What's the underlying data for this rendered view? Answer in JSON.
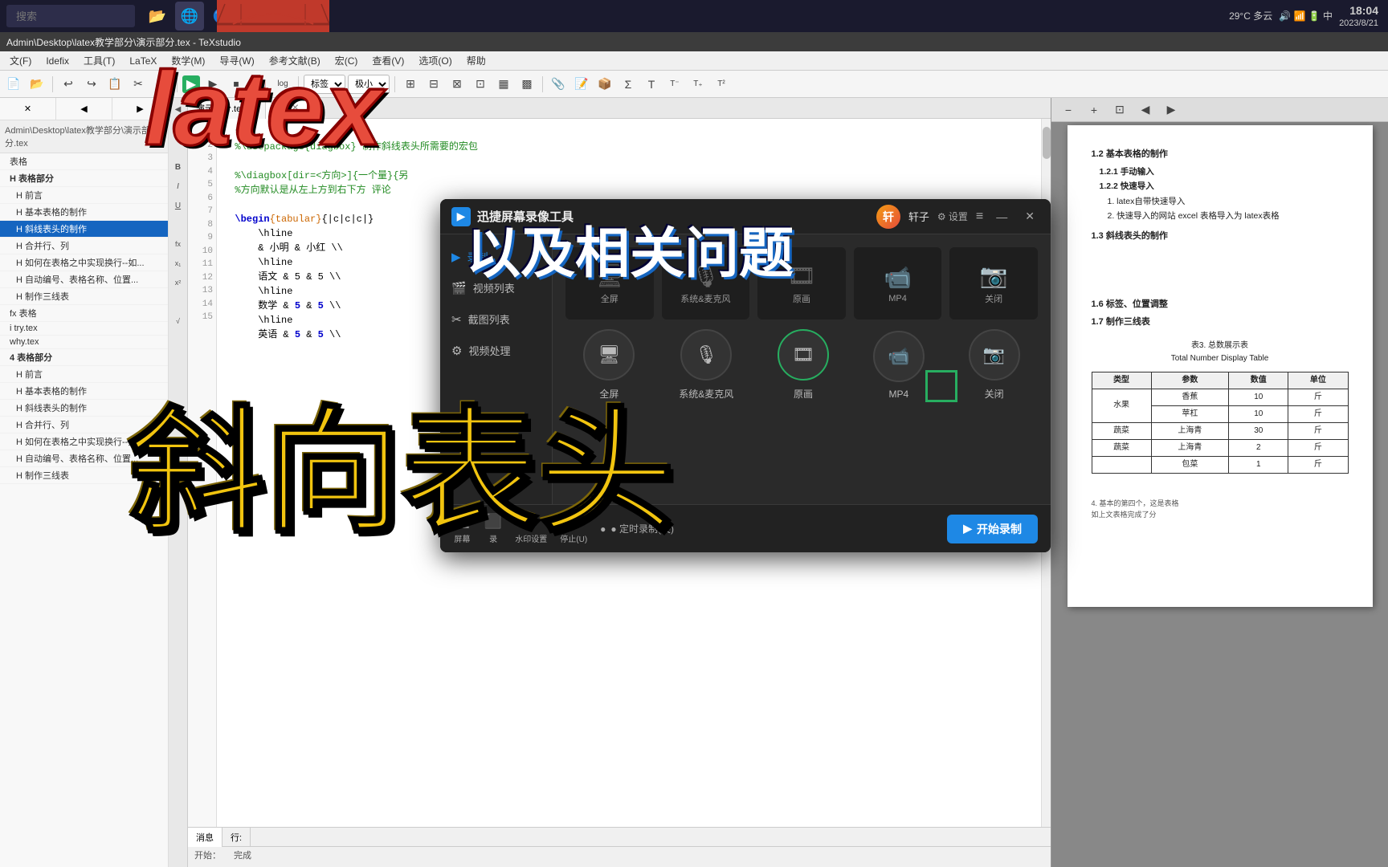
{
  "taskbar": {
    "search_placeholder": "搜索",
    "apps": [
      {
        "id": "folder",
        "icon": "🗂",
        "active": false
      },
      {
        "id": "edge",
        "icon": "🌐",
        "active": false
      },
      {
        "id": "qzone",
        "icon": "🔵",
        "active": false
      },
      {
        "id": "explorer",
        "icon": "📁",
        "active": false
      },
      {
        "id": "vscode",
        "icon": "💻",
        "active": false
      },
      {
        "id": "record",
        "icon": "🎬",
        "active": true
      }
    ],
    "weather": "29°C 多云",
    "icons_right": "：🔊📶🔋中",
    "time": "18:04",
    "date": "2023/8/21"
  },
  "texstudio": {
    "titlebar": "Admin\\Desktop\\latex教学部分\\演示部分.tex - TeXstudio",
    "menus": [
      "文(F)",
      "Idefix",
      "工具(T)",
      "LaTeX",
      "数学(M)",
      "导寻(W)",
      "参考文献(B)",
      "宏(C)",
      "查看(V)",
      "选项(O)",
      "帮助"
    ],
    "toolbar_dropdowns": [
      "标签",
      "极小"
    ],
    "editor_tabs": [
      {
        "label": "演示部分.tex",
        "active": false
      },
      {
        "label": ".tex",
        "active": true
      }
    ],
    "sidebar": {
      "path": "Admin\\Desktop\\latex教学部分\\演示部分.tex",
      "items": [
        {
          "label": "表格",
          "level": 0,
          "indent": 0
        },
        {
          "label": "H  表格部分",
          "level": "H",
          "indent": 0
        },
        {
          "label": "H  前言",
          "level": "H",
          "indent": 1
        },
        {
          "label": "H  基本表格的制作",
          "level": "H",
          "indent": 1
        },
        {
          "label": "H  斜线表头的制作",
          "level": "H",
          "indent": 1,
          "active": true
        },
        {
          "label": "H  合并行、列",
          "level": "H",
          "indent": 1
        },
        {
          "label": "H  如何在表格之中实现换行--如...",
          "level": "H",
          "indent": 1
        },
        {
          "label": "H  自动编号、表格名称、位置...",
          "level": "H",
          "indent": 1
        },
        {
          "label": "H  制作三线表",
          "level": "H",
          "indent": 1
        },
        {
          "label": "fx  表格",
          "level": "fx",
          "indent": 0
        },
        {
          "label": "i try.tex",
          "level": 0,
          "indent": 0
        },
        {
          "label": "why.tex",
          "level": 0,
          "indent": 0
        },
        {
          "label": "4  表格部分",
          "level": "4",
          "indent": 0
        },
        {
          "label": "H  前言",
          "level": "H",
          "indent": 1
        },
        {
          "label": "H  基本表格的制作",
          "level": "H",
          "indent": 1
        },
        {
          "label": "H  斜线表头的制作",
          "level": "H",
          "indent": 1
        },
        {
          "label": "H  合并行、列",
          "level": "H",
          "indent": 1
        },
        {
          "label": "H  如何在表格之中实现换行--如...",
          "level": "H",
          "indent": 1
        },
        {
          "label": "H  自动编号、表格名称、位置...",
          "level": "H",
          "indent": 1
        },
        {
          "label": "H  制作三线表",
          "level": "H",
          "indent": 1
        }
      ]
    },
    "code_lines": [
      "  t{",
      "  %\\usepackage{diagbox} 制作斜线表头所需要的宏包",
      "",
      "  %\\diagbox[dir=<方向>]{一个量}{另",
      "  %方向默认是从左上方到右下方 评论",
      "",
      "  \\begin{tabular}{|c|c|c|}",
      "      \\hline",
      "      & 小明 & 小红 \\\\",
      "      \\hline",
      "      语文 & 5 & 5 \\\\",
      "      \\hline",
      "      数学 & 5 & 5 \\\\",
      "      \\hline",
      "      英语 & 5 & 5 \\\\"
    ],
    "status_tabs": [
      "消息",
      "行:"
    ],
    "status_text": "开始：   完成",
    "status_line": "行: 完成"
  },
  "pdf_panel": {
    "sections": [
      {
        "level": "1.2",
        "text": "基本表格的制作"
      },
      {
        "level": "1.2.1",
        "text": "手动输入"
      },
      {
        "level": "1.2.2",
        "text": "快速导入"
      },
      {
        "sub": "1. latex自带快速导入"
      },
      {
        "sub": "2. 快速导入的网站 excel 表格导入为 latex表格"
      },
      {
        "level": "1.3",
        "text": "斜线表头的制作"
      },
      {
        "level": "1.6",
        "text": "标签、位置调整"
      },
      {
        "level": "1.7",
        "text": "制作三线表"
      }
    ],
    "table": {
      "caption": "表3. 总数展示表",
      "caption_en": "Total Number Display Table",
      "headers": [
        "类型",
        "参数",
        "数值",
        "单位"
      ],
      "rows": [
        [
          "水果",
          "香蕉",
          "10",
          "斤"
        ],
        [
          "",
          "苹杠",
          "10",
          "斤"
        ],
        [
          "",
          "上海青",
          "30",
          "斤"
        ],
        [
          "蔬菜",
          "上海青",
          "2",
          "斤"
        ],
        [
          "",
          "包菜",
          "1",
          "斤"
        ]
      ]
    }
  },
  "recording_dialog": {
    "title": "迅捷屏幕录像工具",
    "user_name": "轩子",
    "settings_label": "⚙ 设置",
    "sidebar_items": [
      {
        "icon": "▶",
        "label": "录制",
        "active": true
      },
      {
        "icon": "🎬",
        "label": "视频列表"
      },
      {
        "icon": "✂",
        "label": "截图列表"
      },
      {
        "icon": "⚙",
        "label": "视频处理"
      }
    ],
    "thumbnails": [
      {
        "label": "全屏"
      },
      {
        "label": "系统&麦克风"
      },
      {
        "label": "原画"
      },
      {
        "label": "MP4"
      },
      {
        "label": "关闭"
      }
    ],
    "screen_options": [
      {
        "label": "全屏",
        "active": false
      },
      {
        "label": "系统&麦克风",
        "active": false
      },
      {
        "label": "原画",
        "active": false
      },
      {
        "label": "MP4",
        "active": false
      },
      {
        "label": "关闭",
        "active": false
      }
    ],
    "start_btn": "开始录制",
    "bottom_tools": [
      {
        "icon": "🖥",
        "label": "屏幕"
      },
      {
        "icon": "⬛",
        "label": "录"
      },
      {
        "icon": "💧",
        "label": "水印设置"
      },
      {
        "icon": "⏱",
        "label": "停止(U)"
      }
    ],
    "timer_label": "● 定时录制(关)"
  },
  "overlay": {
    "latex_text": "latex",
    "subtitle_text": "以及相关问题",
    "diag_head_text": "斜向表头"
  }
}
